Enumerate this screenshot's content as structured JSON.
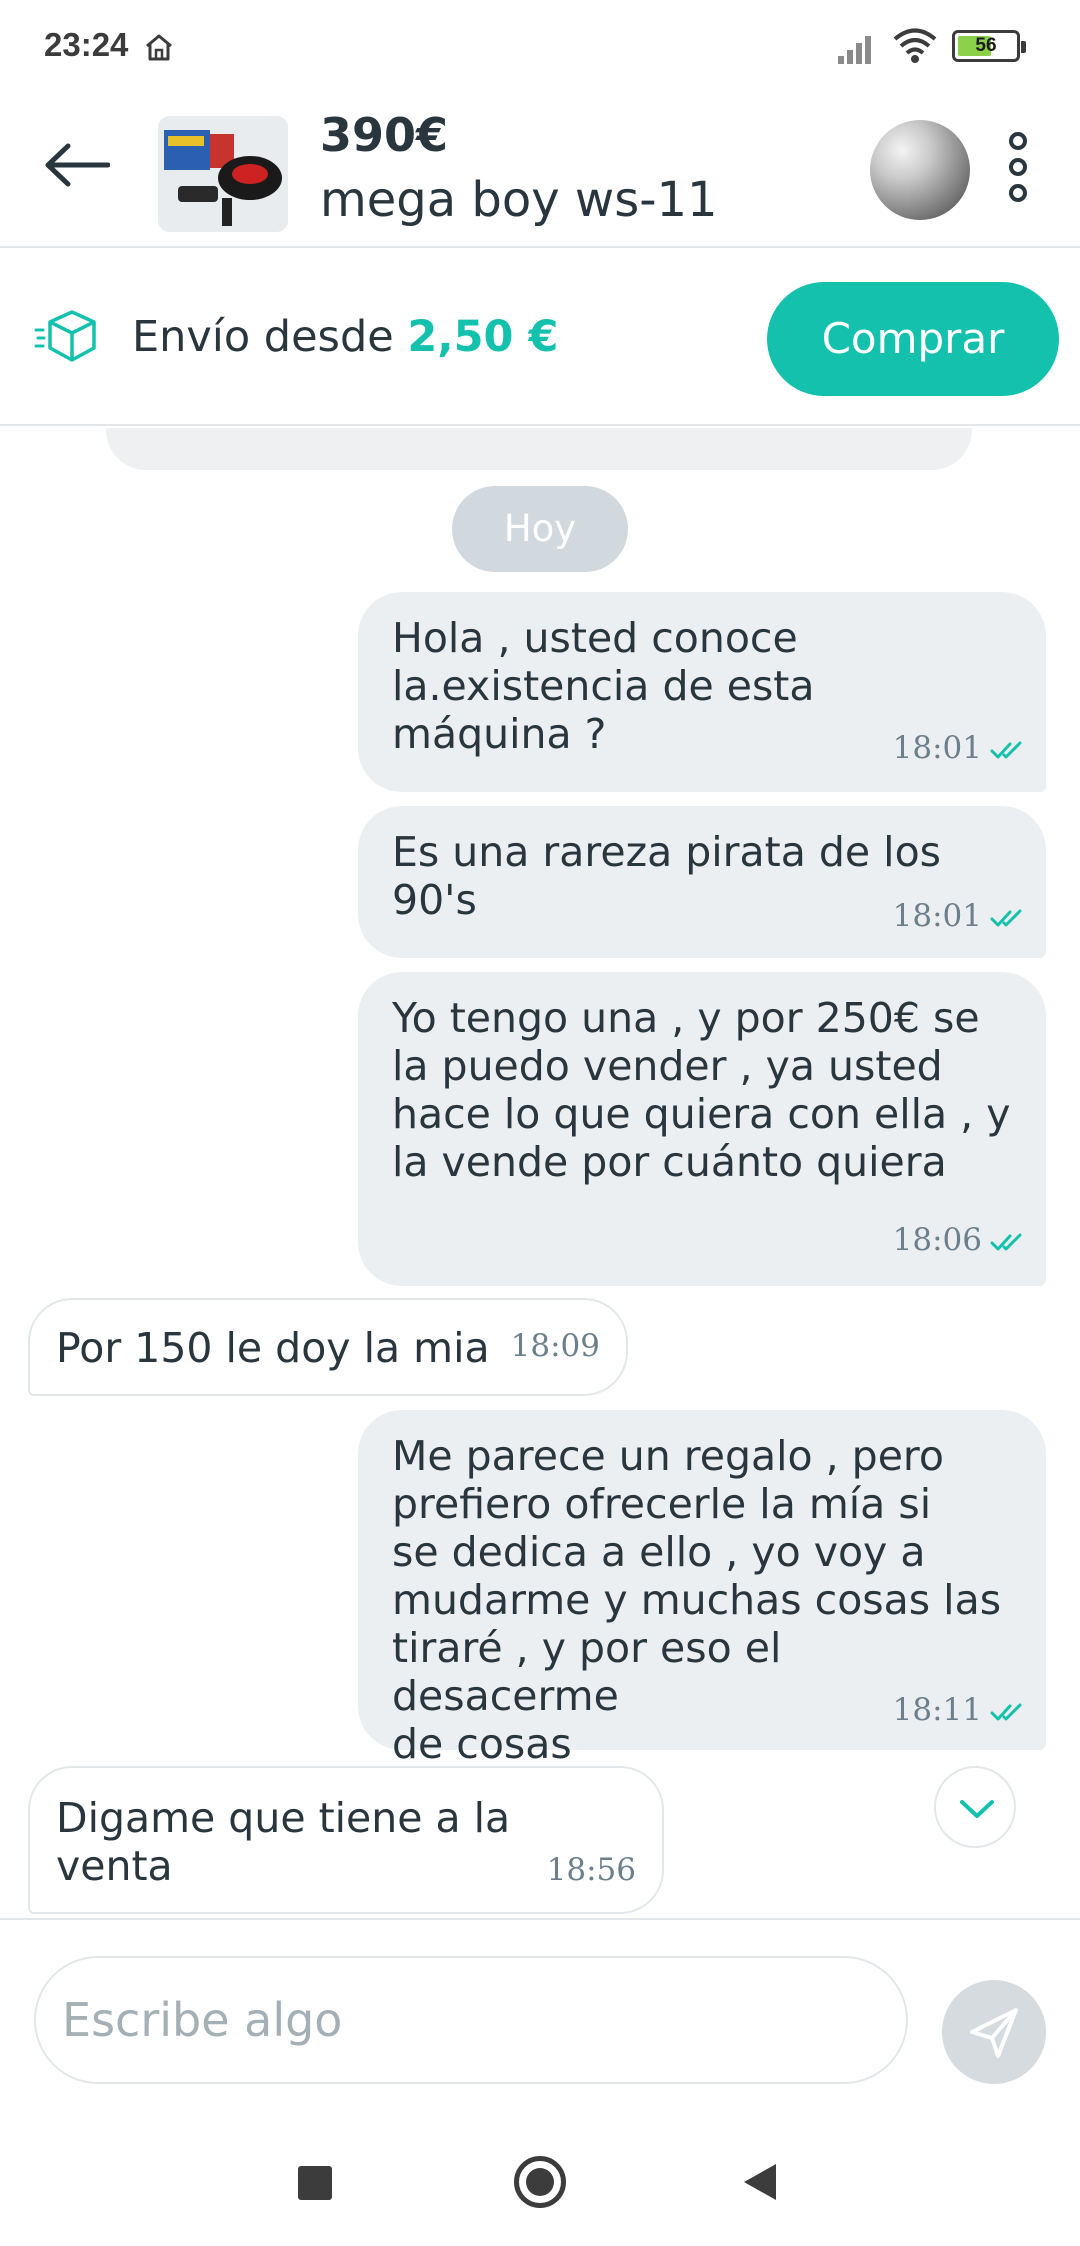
{
  "status": {
    "time": "23:24",
    "battery": "56"
  },
  "header": {
    "price": "390€",
    "title": "mega boy ws-11"
  },
  "shipping": {
    "prefix": "Envío desde",
    "price": "2,50 €",
    "buy_label": "Comprar"
  },
  "chat": {
    "date_label": "Hoy",
    "messages": [
      {
        "direction": "out",
        "text": "Hola , usted conoce\nla.existencia de esta\nmáquina ?",
        "time": "18:01"
      },
      {
        "direction": "out",
        "text": "Es una rareza pirata de los\n90's",
        "time": "18:01"
      },
      {
        "direction": "out",
        "text": "Yo tengo una , y por 250€ se\nla puedo vender , ya usted\nhace lo que quiera con ella , y\nla vende por cuánto quiera",
        "time": "18:06"
      },
      {
        "direction": "in",
        "text": "Por 150 le doy la mia",
        "time": "18:09"
      },
      {
        "direction": "out",
        "text": "Me parece un regalo , pero\nprefiero ofrecerle la mía si\nse dedica a ello , yo voy a\nmudarme y muchas cosas las\ntiraré , y por eso el desacerme\nde cosas",
        "time": "18:11"
      },
      {
        "direction": "in",
        "text": "Digame que tiene a la venta",
        "time": "18:56"
      }
    ]
  },
  "composer": {
    "placeholder": "Escribe algo"
  },
  "icons": {
    "back": "arrow-left-icon",
    "more": "kebab-menu-icon",
    "shipping": "box-icon",
    "read": "double-check-icon",
    "scroll": "chevron-down-icon",
    "send": "send-icon"
  },
  "colors": {
    "accent": "#13c1ac",
    "text": "#29363d",
    "bubble_out": "#eceff2",
    "meta": "#6c7f8c"
  }
}
